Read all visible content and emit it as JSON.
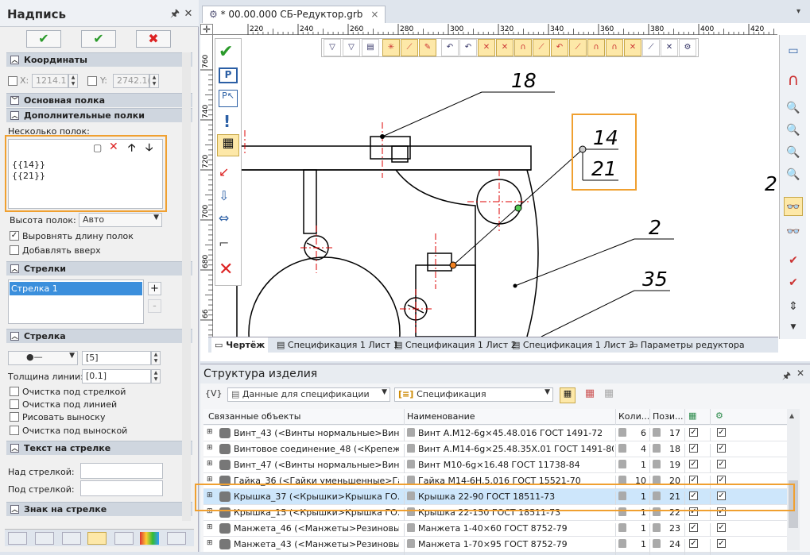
{
  "left_panel": {
    "title": "Надпись",
    "pin_glyph": "🖈",
    "close_glyph": "✕",
    "ok_glyph": "✔",
    "apply_glyph": "✔",
    "cancel_glyph": "✖",
    "sections": {
      "coords": "Координаты",
      "main_shelf": "Основная полка",
      "extra_shelves": "Дополнительные полки",
      "arrows": "Стрелки",
      "arrow": "Стрелка",
      "arrow_text": "Текст на стрелке",
      "arrow_sign": "Знак на стрелке"
    },
    "x_label": "X:",
    "x_value": "1214.1",
    "y_label": "Y:",
    "y_value": "2742.1(",
    "shelves_label": "Несколько полок:",
    "shelves_text": [
      "{{14}}",
      "{{21}}"
    ],
    "shelf_height_label": "Высота полок:",
    "shelf_height_value": "Авто",
    "align_length_label": "Выровнять длину полок",
    "add_up_label": "Добавлять вверх",
    "arrow_list_item": "Стрелка 1",
    "add_glyph": "+",
    "remove_glyph": "-",
    "arrow_style_value": "[5]",
    "line_width_label": "Толщина линии:",
    "line_width_value": "[0.1]",
    "clear_under_arrow": "Очистка под стрелкой",
    "clear_under_line": "Очистка под линией",
    "draw_leader": "Рисовать выноску",
    "clear_under_leader": "Очистка под выноской",
    "above_arrow_label": "Над стрелкой:",
    "below_arrow_label": "Под стрелкой:"
  },
  "document": {
    "tab_title": "* 00.00.000 СБ-Редуктор.grb",
    "tab_close": "×",
    "ruler_top": [
      "220",
      "240",
      "260",
      "280",
      "300",
      "320",
      "340",
      "360",
      "380",
      "400",
      "420"
    ],
    "ruler_left": [
      "760",
      "740",
      "720",
      "700",
      "680",
      "66"
    ],
    "callouts": [
      "18",
      "14",
      "21",
      "2",
      "35",
      "2"
    ],
    "sheet_tabs": [
      "Чертёж",
      "Спецификация 1 Лист 1",
      "Спецификация 1 Лист 2",
      "Спецификация 1 Лист 3",
      "Параметры редуктора"
    ]
  },
  "structure": {
    "title": "Структура изделия",
    "var_button": "{V}",
    "source_dropdown": "Данные для спецификации",
    "spec_dropdown": "Спецификация",
    "columns": [
      "Связанные объекты",
      "Наименование",
      "Коли...",
      "Пози..."
    ],
    "rows": [
      {
        "obj": "Винт_43 (<Винты нормальные>Винт...",
        "name": "Винт А.М12-6g×45.48.016 ГОСТ 1491-72",
        "qty": "6",
        "pos": "17",
        "c1": true,
        "c2": true,
        "selected": false
      },
      {
        "obj": "Винтовое соединение_48 (<Крепежн...",
        "name": "Винт А.М14-6g×25.48.35Х.01 ГОСТ 1491-80",
        "qty": "4",
        "pos": "18",
        "c1": true,
        "c2": true,
        "selected": false
      },
      {
        "obj": "Винт_47 (<Винты нормальные>Винт...",
        "name": "Винт М10-6g×16.48 ГОСТ 11738-84",
        "qty": "1",
        "pos": "19",
        "c1": true,
        "c2": true,
        "selected": false
      },
      {
        "obj": "Гайка_36 (<Гайки уменьшенные>Га...",
        "name": "Гайка М14-6H.5.016 ГОСТ 15521-70",
        "qty": "10",
        "pos": "20",
        "c1": true,
        "c2": true,
        "selected": false
      },
      {
        "obj": "Крышка_37 (<Крышки>Крышка ГО...",
        "name": "Крышка 22-90 ГОСТ 18511-73",
        "qty": "1",
        "pos": "21",
        "c1": true,
        "c2": true,
        "selected": true
      },
      {
        "obj": "Крышка_15 (<Крышки>Крышка ГО...",
        "name": "Крышка 22-150 ГОСТ 18511-73",
        "qty": "1",
        "pos": "22",
        "c1": true,
        "c2": true,
        "selected": false
      },
      {
        "obj": "Манжета_46 (<Манжеты>Резиновы...",
        "name": "Манжета 1-40×60 ГОСТ 8752-79",
        "qty": "1",
        "pos": "23",
        "c1": true,
        "c2": true,
        "selected": false
      },
      {
        "obj": "Манжета_43 (<Манжеты>Резиновы...",
        "name": "Манжета 1-70×95 ГОСТ 8752-79",
        "qty": "1",
        "pos": "24",
        "c1": true,
        "c2": true,
        "selected": false
      }
    ]
  },
  "colors": {
    "accent_orange": "#f0a030",
    "selection": "#cde6fb",
    "ok_green": "#2a9a2a",
    "cancel_red": "#d22"
  }
}
